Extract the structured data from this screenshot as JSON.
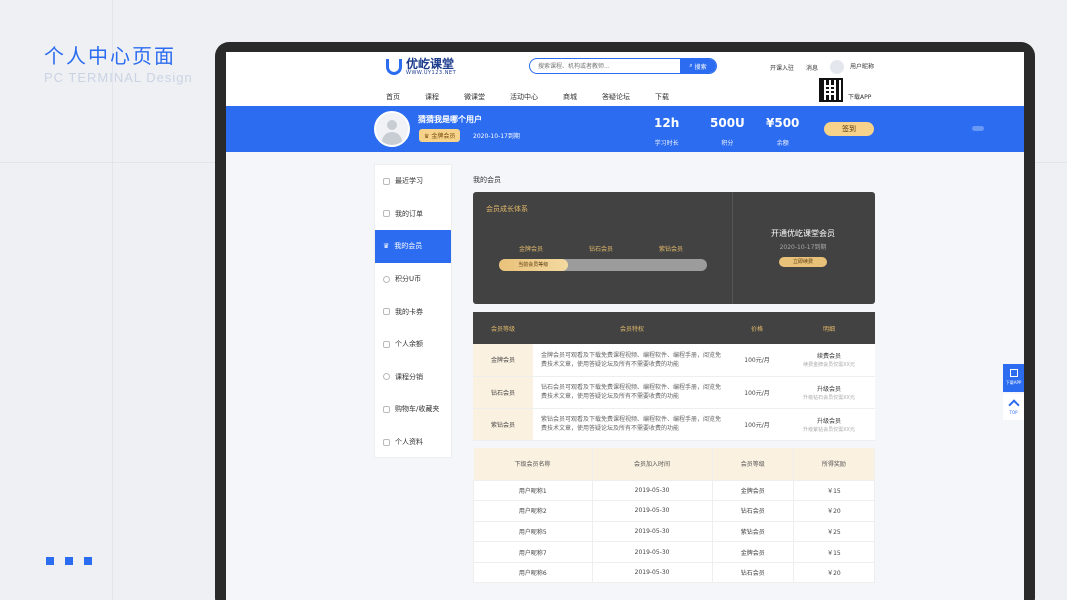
{
  "presentation": {
    "title": "个人中心页面",
    "subtitle": "PC TERMINAL Design"
  },
  "header": {
    "logo_text": "优屹课堂",
    "logo_url": "WWW.UY123.NET",
    "search_placeholder": "搜索课程、机构或者教师...",
    "search_button": "搜索",
    "links": [
      "开课入驻",
      "消息"
    ],
    "username": "用户昵称",
    "nav": [
      "首页",
      "课程",
      "微课堂",
      "活动中心",
      "商城",
      "答疑论坛",
      "下载"
    ],
    "download_app": "下载APP"
  },
  "banner": {
    "name": "猜猜我是哪个用户",
    "badge": "金牌会员",
    "expire": "2020-10-17到期",
    "stats": [
      {
        "value": "12h",
        "label": "学习时长"
      },
      {
        "value": "500U",
        "label": "积分"
      },
      {
        "value": "¥500",
        "label": "余额"
      }
    ],
    "signin": "签到"
  },
  "sidebar": {
    "items": [
      {
        "label": "最近学习",
        "icon": "book-icon"
      },
      {
        "label": "我的订单",
        "icon": "order-icon"
      },
      {
        "label": "我的会员",
        "icon": "crown-icon",
        "active": true
      },
      {
        "label": "积分U币",
        "icon": "coin-icon"
      },
      {
        "label": "我的卡券",
        "icon": "ticket-icon"
      },
      {
        "label": "个人余额",
        "icon": "wallet-icon"
      },
      {
        "label": "课程分销",
        "icon": "share-icon"
      },
      {
        "label": "购物车/收藏夹",
        "icon": "cart-icon"
      },
      {
        "label": "个人资料",
        "icon": "profile-icon"
      }
    ]
  },
  "main": {
    "title": "我的会员",
    "growth": {
      "title": "会员成长体系",
      "levels": [
        "金牌会员",
        "钻石会员",
        "紫钻会员"
      ],
      "current_label": "当前会员等级",
      "progress": 0.33,
      "open_title": "开通优屹课堂会员",
      "open_date": "2020-10-17到期",
      "renew_button": "立即续费"
    },
    "privileges": {
      "headers": [
        "会员等级",
        "会员特权",
        "价格",
        "明细"
      ],
      "rows": [
        {
          "level": "金牌会员",
          "desc": "金牌会员可观看及下载免费课程视频、编程软件、编程手册，阅览免费技术文章，使用答疑论坛及所有不需要收费的功能",
          "price": "100元/月",
          "action": "续费会员",
          "note": "续费金牌会员仅需XX元"
        },
        {
          "level": "钻石会员",
          "desc": "钻石会员可观看及下载免费课程视频、编程软件、编程手册，阅览免费技术文章，使用答疑论坛及所有不需要收费的功能",
          "price": "100元/月",
          "action": "升级会员",
          "note": "升级钻石会员仅需XX元"
        },
        {
          "level": "紫钻会员",
          "desc": "紫钻会员可观看及下载免费课程视频、编程软件、编程手册，阅览免费技术文章，使用答疑论坛及所有不需要收费的功能",
          "price": "100元/月",
          "action": "升级会员",
          "note": "升级紫钻会员仅需XX元"
        }
      ]
    },
    "referrals": {
      "headers": [
        "下级会员名称",
        "会员加入时间",
        "会员等级",
        "所得奖励"
      ],
      "rows": [
        [
          "用户昵称1",
          "2019-05-30",
          "金牌会员",
          "￥15"
        ],
        [
          "用户昵称2",
          "2019-05-30",
          "钻石会员",
          "￥20"
        ],
        [
          "用户昵称5",
          "2019-05-30",
          "紫钻会员",
          "￥25"
        ],
        [
          "用户昵称7",
          "2019-05-30",
          "金牌会员",
          "￥15"
        ],
        [
          "用户昵称6",
          "2019-05-30",
          "钻石会员",
          "￥20"
        ]
      ]
    }
  },
  "float": {
    "download": "下载APP",
    "top": "TOP"
  }
}
